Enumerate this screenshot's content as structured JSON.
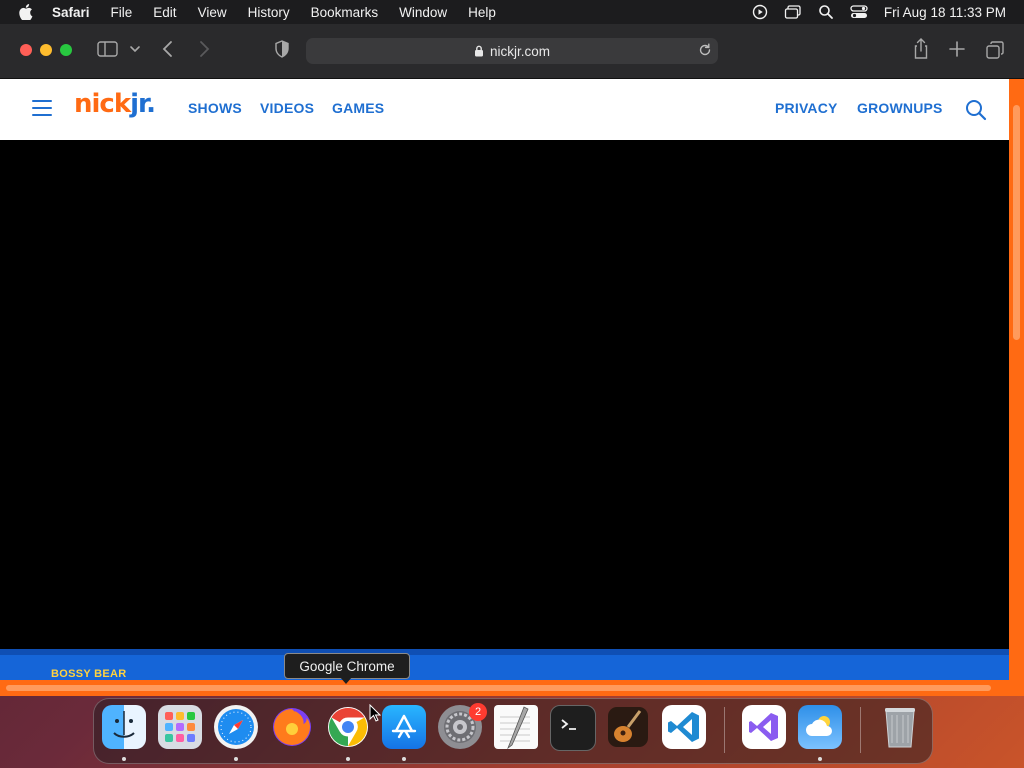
{
  "menubar": {
    "app_name": "Safari",
    "items": [
      "File",
      "Edit",
      "View",
      "History",
      "Bookmarks",
      "Window",
      "Help"
    ],
    "datetime": "Fri Aug 18  11:33 PM"
  },
  "browser": {
    "url": "nickjr.com"
  },
  "site": {
    "logo_main": "nick",
    "logo_accent": "jr.",
    "nav": {
      "shows": "SHOWS",
      "videos": "VIDEOS",
      "games": "GAMES",
      "privacy": "PRIVACY",
      "grownups": "GROWNUPS"
    },
    "show_title": "BOSSY BEAR"
  },
  "tooltip": {
    "text": "Google Chrome"
  },
  "dock": {
    "apps": [
      "Finder",
      "Launchpad",
      "Safari",
      "Firefox",
      "Google Chrome",
      "App Store",
      "System Settings",
      "TextEdit",
      "Terminal",
      "GarageBand",
      "Visual Studio Code",
      "Visual Studio",
      "Weather",
      "Trash"
    ],
    "settings_badge": "2"
  },
  "colors": {
    "nick_orange": "#ff6a13",
    "nick_blue": "#1f6fd1",
    "band_blue": "#1565d8",
    "show_title_yellow": "#ffd23f"
  }
}
